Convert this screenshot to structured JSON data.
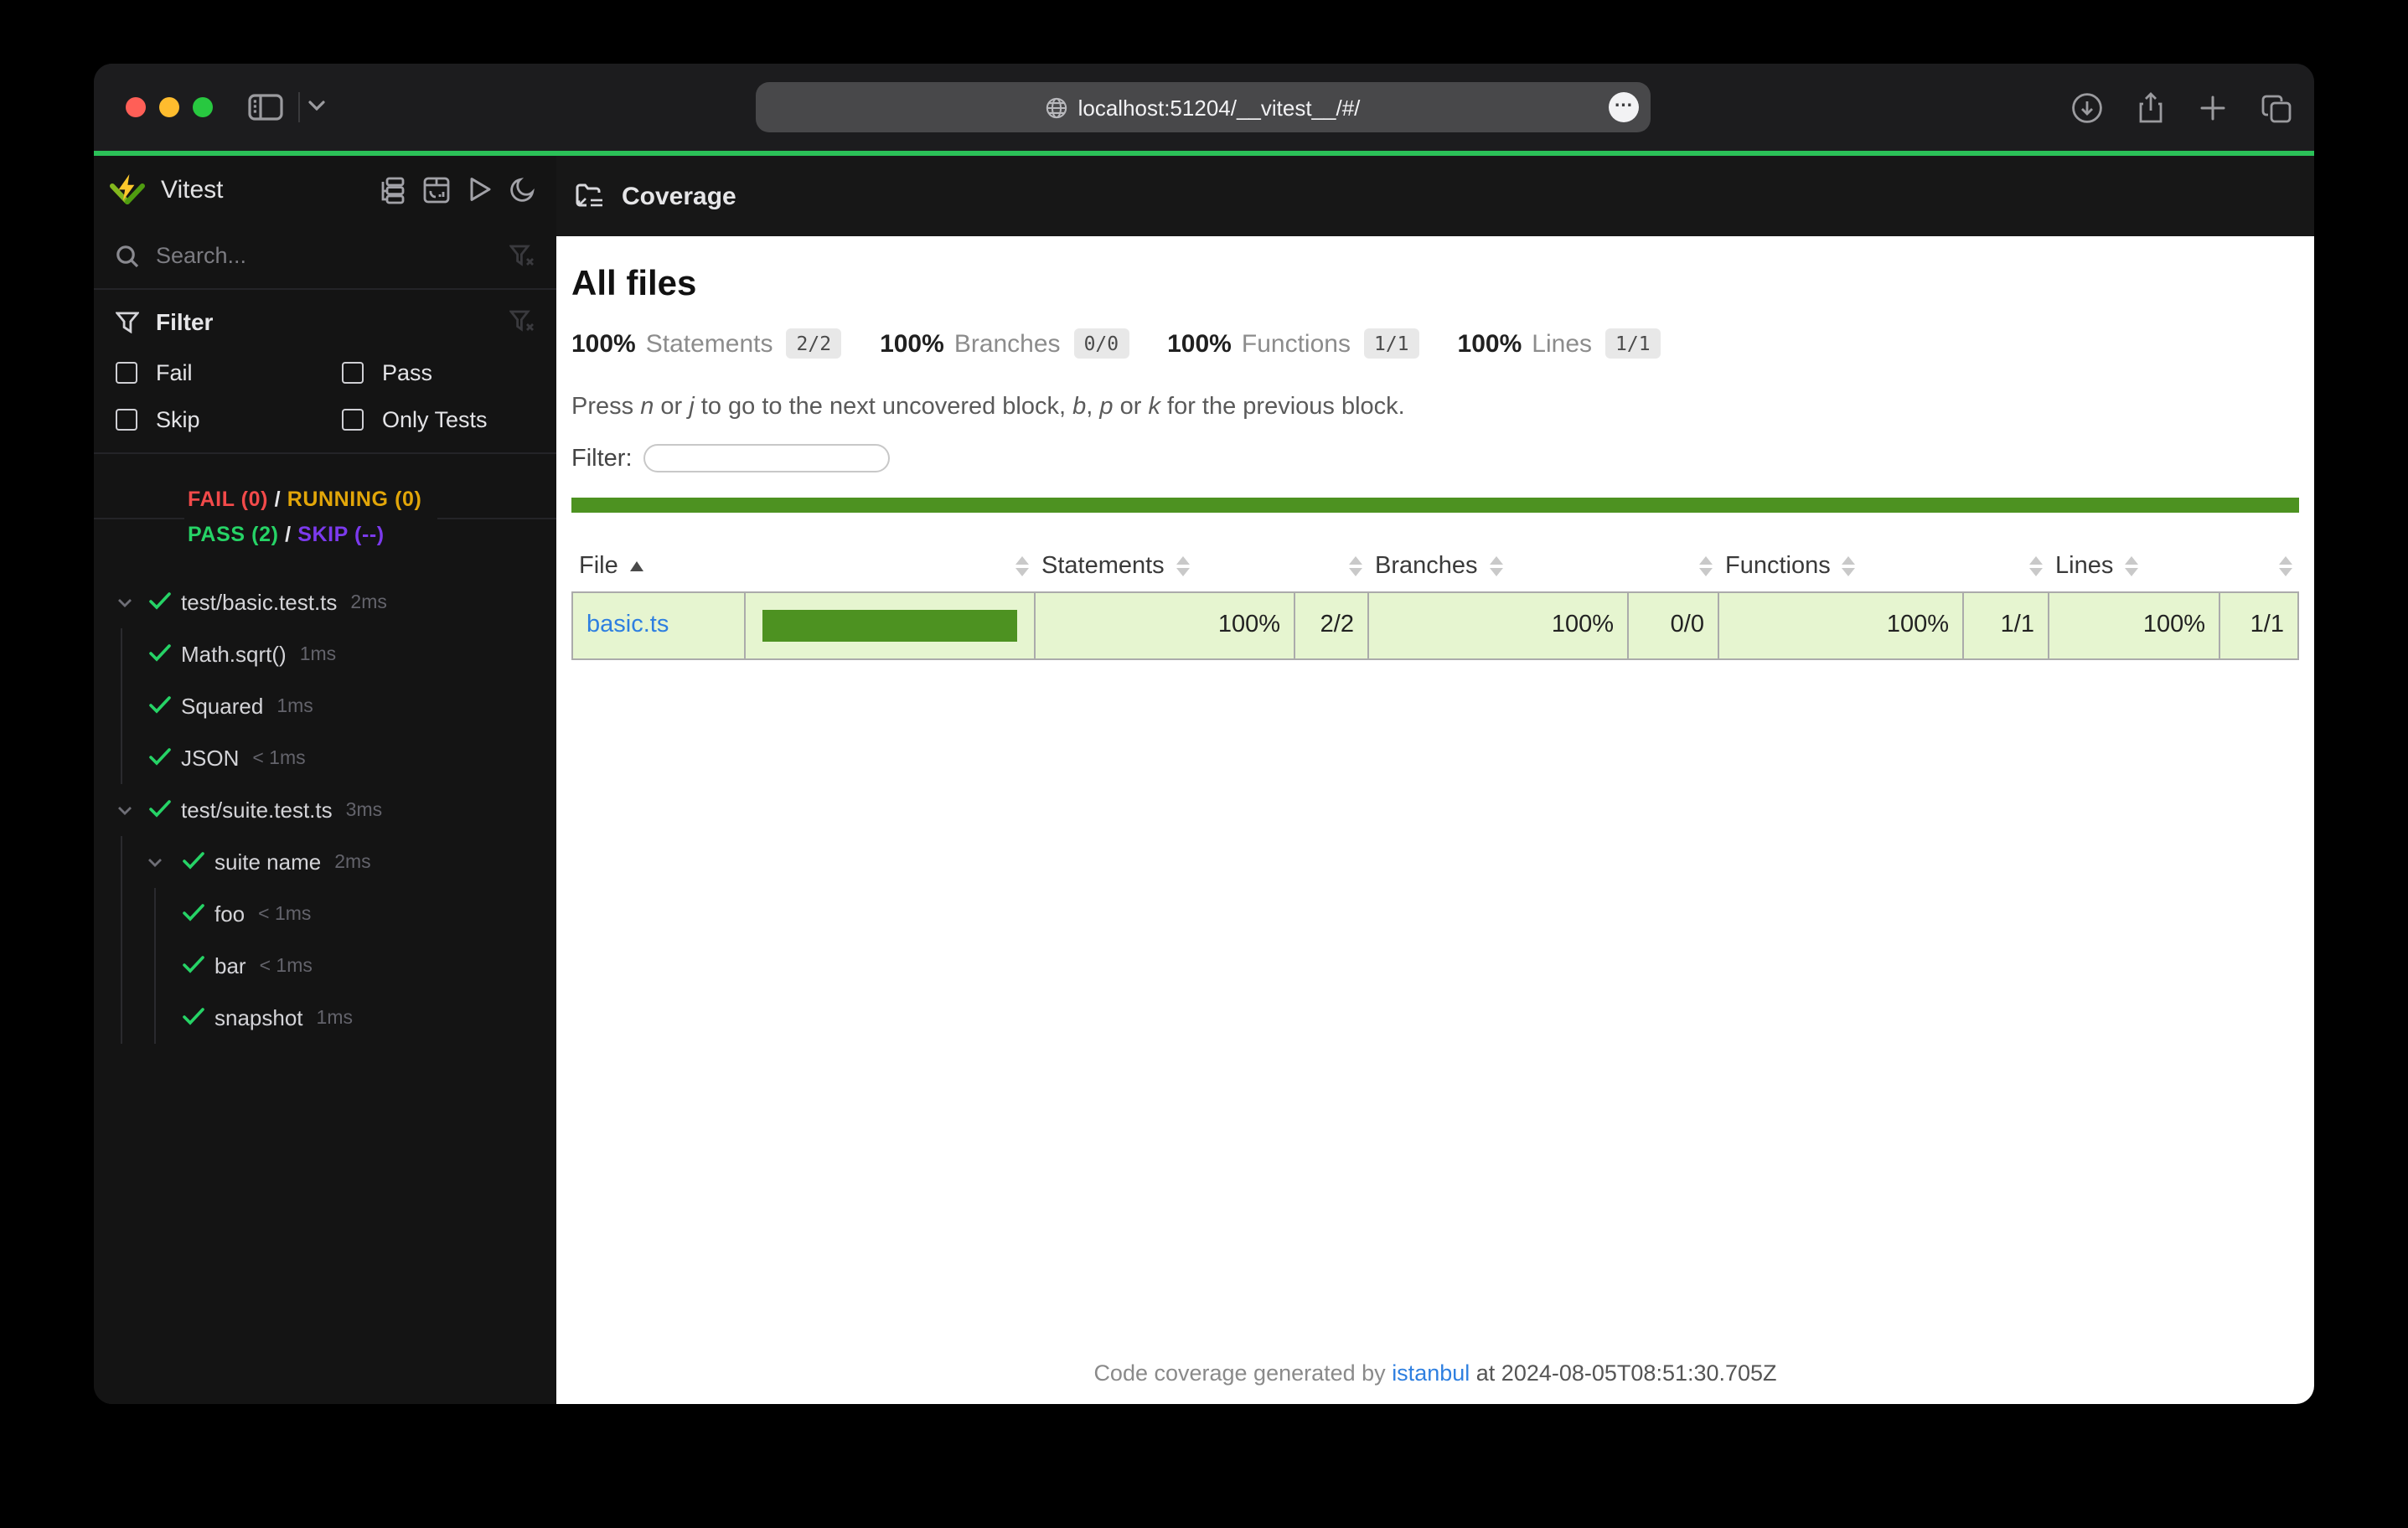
{
  "browser": {
    "url": "localhost:51204/__vitest__/#/",
    "more_glyph": "•••",
    "colors": {
      "close": "#ff5f57",
      "minimize": "#febc2e",
      "zoom": "#28c840",
      "accent_line": "#2bc158"
    }
  },
  "sidebar": {
    "app_name": "Vitest",
    "search_placeholder": "Search...",
    "filter": {
      "title": "Filter",
      "options": [
        {
          "label": "Fail"
        },
        {
          "label": "Pass"
        },
        {
          "label": "Skip"
        },
        {
          "label": "Only Tests"
        }
      ]
    },
    "status": {
      "fail": "FAIL (0)",
      "running": "RUNNING (0)",
      "pass": "PASS (2)",
      "skip": "SKIP (--)",
      "sep": " / ",
      "colors": {
        "fail": "#f24a4a",
        "running": "#e2a609",
        "pass": "#26d366",
        "skip": "#7c3aed"
      }
    },
    "tree": [
      {
        "label": "test/basic.test.ts",
        "time": "2ms"
      },
      {
        "label": "Math.sqrt()",
        "time": "1ms"
      },
      {
        "label": "Squared",
        "time": "1ms"
      },
      {
        "label": "JSON",
        "time": "< 1ms"
      },
      {
        "label": "test/suite.test.ts",
        "time": "3ms"
      },
      {
        "label": "suite name",
        "time": "2ms"
      },
      {
        "label": "foo",
        "time": "< 1ms"
      },
      {
        "label": "bar",
        "time": "< 1ms"
      },
      {
        "label": "snapshot",
        "time": "1ms"
      }
    ]
  },
  "coverage": {
    "panel_title": "Coverage",
    "heading": "All files",
    "summary": [
      {
        "pct": "100%",
        "label": "Statements",
        "frac": "2/2"
      },
      {
        "pct": "100%",
        "label": "Branches",
        "frac": "0/0"
      },
      {
        "pct": "100%",
        "label": "Functions",
        "frac": "1/1"
      },
      {
        "pct": "100%",
        "label": "Lines",
        "frac": "1/1"
      }
    ],
    "hint": {
      "p1": "Press ",
      "k1": "n",
      "p2": " or ",
      "k2": "j",
      "p3": " to go to the next uncovered block, ",
      "k3": "b",
      "p4": ", ",
      "k4": "p",
      "p5": " or ",
      "k5": "k",
      "p6": " for the previous block."
    },
    "filter_label": "Filter:",
    "table": {
      "headers": {
        "file": "File",
        "statements": "Statements",
        "branches": "Branches",
        "functions": "Functions",
        "lines": "Lines"
      },
      "row": {
        "file": "basic.ts",
        "bar_pct": 100,
        "statements_pct": "100%",
        "statements_frac": "2/2",
        "branches_pct": "100%",
        "branches_frac": "0/0",
        "functions_pct": "100%",
        "functions_frac": "1/1",
        "lines_pct": "100%",
        "lines_frac": "1/1"
      }
    },
    "footer": {
      "prefix": "Code coverage generated by ",
      "link": "istanbul",
      "suffix": " at 2024-08-05T08:51:30.705Z"
    },
    "colors": {
      "high_bg": "#e6f5d0",
      "bar_fill": "#4d9221",
      "status_line": "#4d9221",
      "link": "#2e7fe0"
    }
  }
}
